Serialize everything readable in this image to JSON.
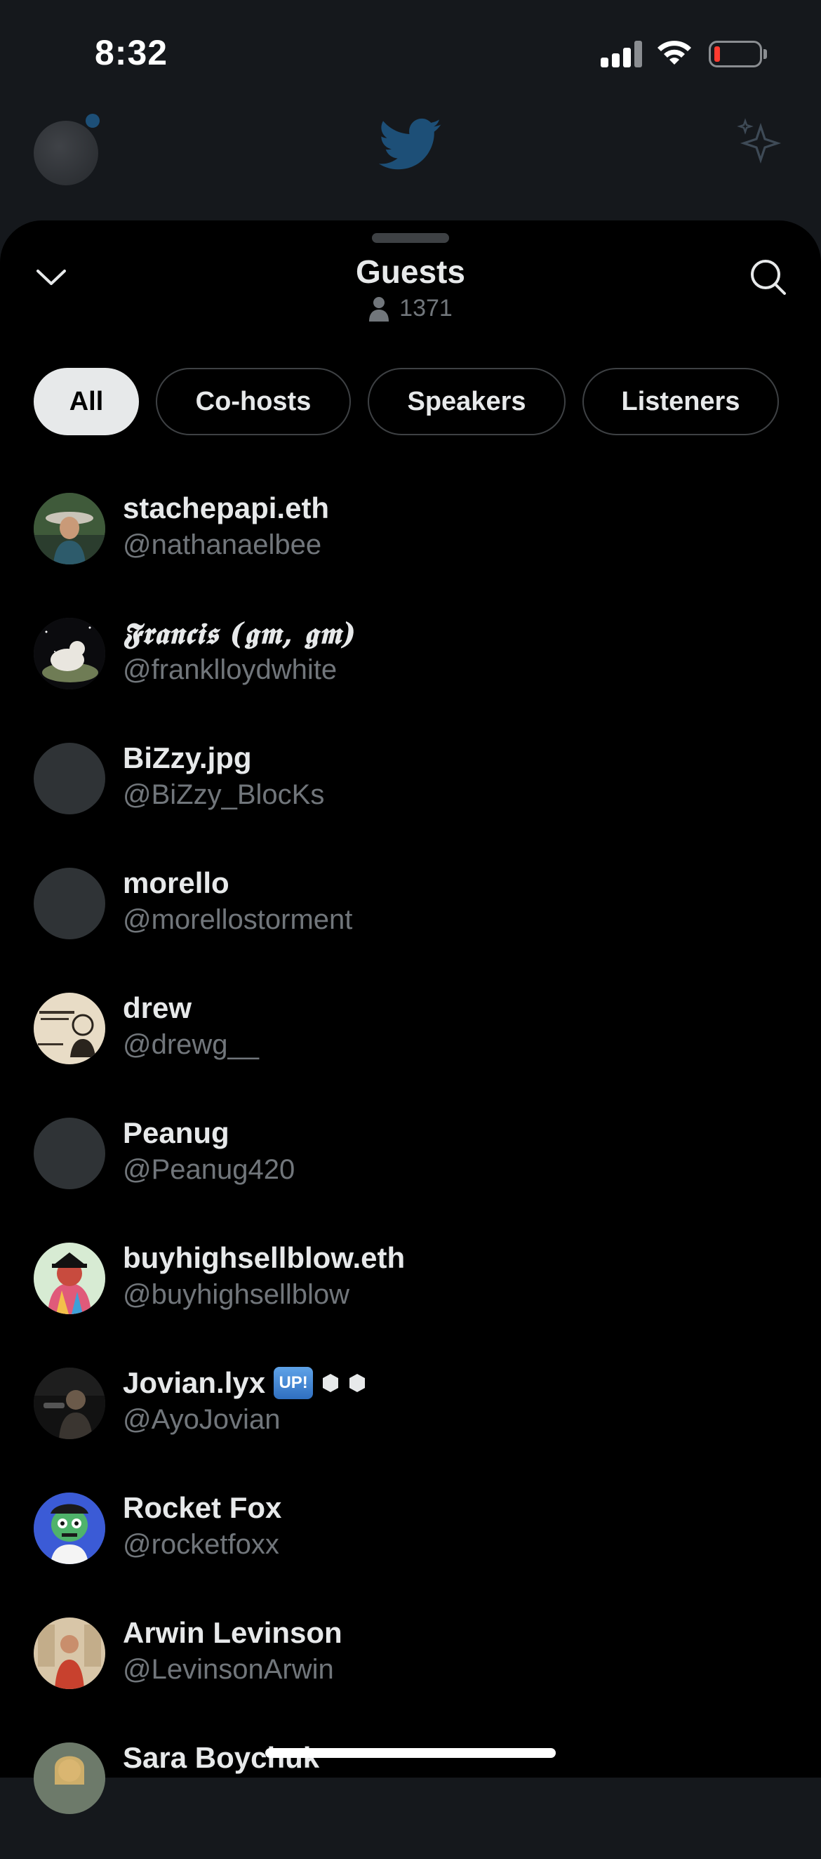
{
  "status_bar": {
    "time": "8:32"
  },
  "sheet": {
    "title": "Guests",
    "count": "1371"
  },
  "filters": [
    {
      "label": "All",
      "active": true
    },
    {
      "label": "Co-hosts",
      "active": false
    },
    {
      "label": "Speakers",
      "active": false
    },
    {
      "label": "Listeners",
      "active": false
    }
  ],
  "guests": [
    {
      "name": "stachepapi.eth",
      "handle": "@nathanaelbee"
    },
    {
      "name": "𝕱𝖗𝖆𝖓𝖈𝖎𝖘 (𝖌𝖒, 𝖌𝖒)",
      "handle": "@franklloydwhite"
    },
    {
      "name": "BiZzy.jpg",
      "handle": "@BiZzy_BlocKs"
    },
    {
      "name": "morello",
      "handle": "@morellostorment"
    },
    {
      "name": "drew",
      "handle": "@drewg__"
    },
    {
      "name": "Peanug",
      "handle": "@Peanug420"
    },
    {
      "name": "buyhighsellblow.eth",
      "handle": "@buyhighsellblow"
    },
    {
      "name": "Jovian.lyx",
      "handle": "@AyoJovian",
      "badge": "UP!"
    },
    {
      "name": "Rocket Fox",
      "handle": "@rocketfoxx"
    },
    {
      "name": "Arwin Levinson",
      "handle": "@LevinsonArwin"
    },
    {
      "name": "Sara Boychuk",
      "handle": ""
    }
  ],
  "colors": {
    "background": "#000000",
    "dim_background": "#15181c",
    "primary_text": "#e7e9ea",
    "secondary_text": "#71767b",
    "pill_border": "#3e4144",
    "twitter_blue": "#1d9bf0"
  },
  "icons": {
    "collapse": "chevron-down-icon",
    "search": "search-icon",
    "count": "person-icon",
    "brand": "twitter-bird-icon",
    "sparkle": "sparkle-icon"
  }
}
